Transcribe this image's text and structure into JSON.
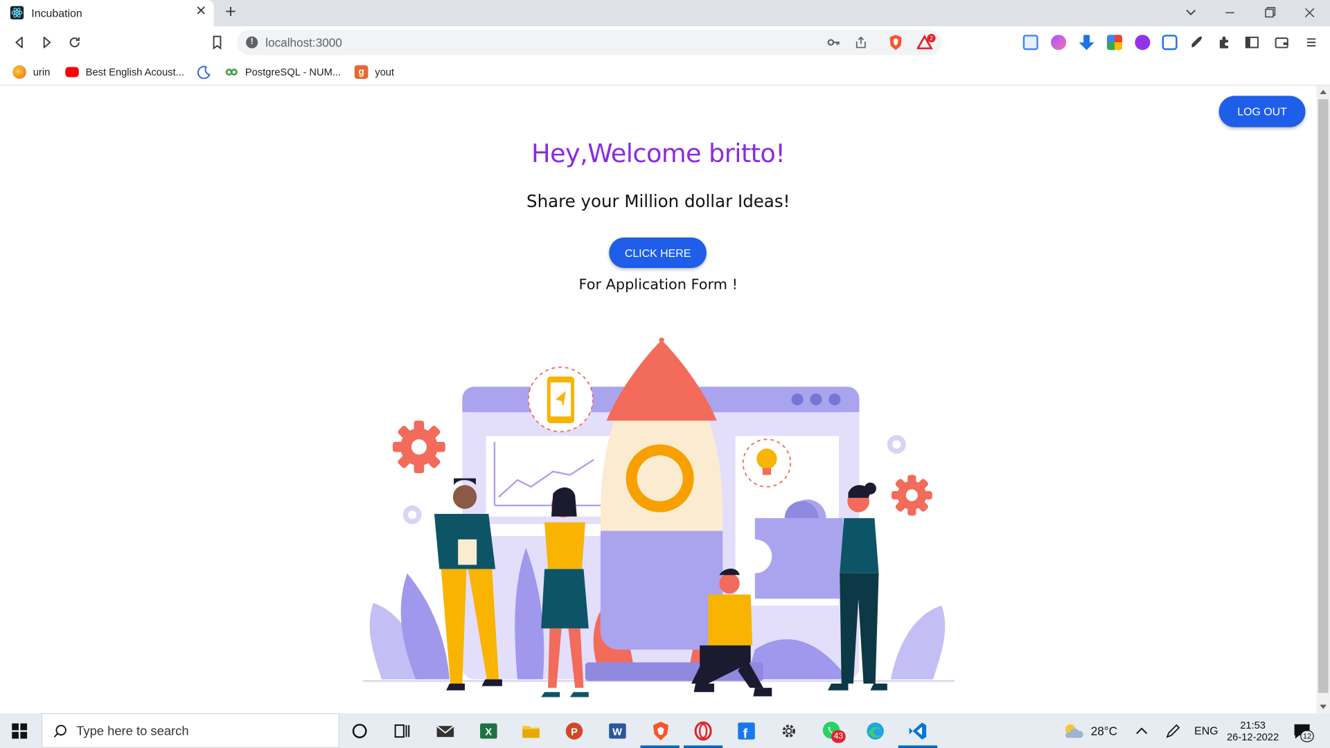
{
  "browser": {
    "tab_title": "Incubation",
    "tab_close": "✕",
    "new_tab": "+",
    "url": "localhost:3000",
    "shield_count": "2",
    "bookmarks": [
      {
        "label": "urin",
        "icon": "firefox-icon",
        "color": "#e8692b"
      },
      {
        "label": "Best English Acoust...",
        "icon": "youtube-icon",
        "color": "#ff0000"
      },
      {
        "label": "",
        "icon": "moon-icon",
        "color": "#2d6bd8"
      },
      {
        "label": "PostgreSQL - NUM...",
        "icon": "link-icon",
        "color": "#3a9a3a"
      },
      {
        "label": "yout",
        "icon": "g-icon",
        "color": "#e8692b"
      }
    ]
  },
  "page": {
    "logout_label": "LOG OUT",
    "welcome": "Hey,Welcome britto!",
    "subtitle": "Share your Million dollar Ideas!",
    "click_label": "CLICK HERE",
    "form_text": "For Application Form !"
  },
  "taskbar": {
    "search_placeholder": "Type here to search",
    "temperature": "28°C",
    "language": "ENG",
    "time": "21:53",
    "date": "26-12-2022",
    "whatsapp_badge": "43",
    "notif_count": "12"
  },
  "colors": {
    "accent_button": "#1e5ee8",
    "welcome_text": "#8a2be2"
  }
}
